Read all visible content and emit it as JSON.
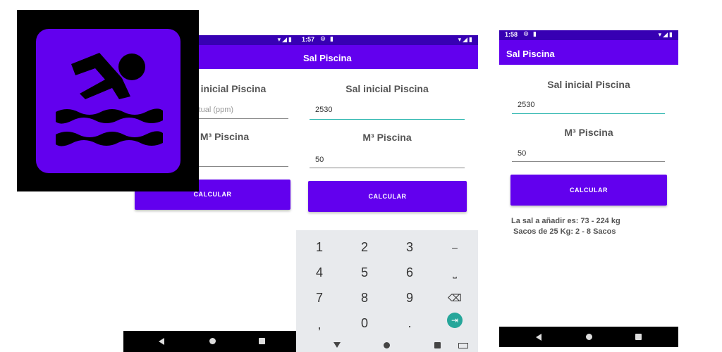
{
  "screen1": {
    "field1_label": "Sal inicial Piscina",
    "field1_placeholder": "Sal actual (ppm)",
    "field2_label": "M³ Piscina",
    "button": "CALCULAR"
  },
  "screen2": {
    "time": "1:57",
    "title": "Sal Piscina",
    "field1_label": "Sal inicial Piscina",
    "field1_value": "2530",
    "field2_label": "M³ Piscina",
    "field2_value": "50",
    "button": "CALCULAR",
    "keypad": {
      "row1": [
        "1",
        "2",
        "3",
        "–"
      ],
      "row2": [
        "4",
        "5",
        "6",
        "⎵"
      ],
      "row3": [
        "7",
        "8",
        "9",
        "⌫"
      ],
      "row4": [
        ",",
        "0",
        ".",
        "⇥"
      ]
    }
  },
  "screen3": {
    "time": "1:58",
    "title": "Sal Piscina",
    "field1_label": "Sal inicial Piscina",
    "field1_value": "2530",
    "field2_label": "M³ Piscina",
    "field2_value": "50",
    "button": "CALCULAR",
    "result_line1": "La sal a añadir es: 73 - 224 kg",
    "result_line2": "Sacos de 25 Kg: 2 - 8 Sacos"
  },
  "colors": {
    "primary": "#6200ee",
    "primary_dark": "#3700b3",
    "accent": "#20b2aa"
  },
  "icons": {
    "app": "swimmer-icon",
    "status": [
      "wifi-icon",
      "signal-icon",
      "battery-icon",
      "settings-icon",
      "sd-card-icon"
    ],
    "nav": [
      "back-icon",
      "home-icon",
      "recents-icon"
    ]
  }
}
